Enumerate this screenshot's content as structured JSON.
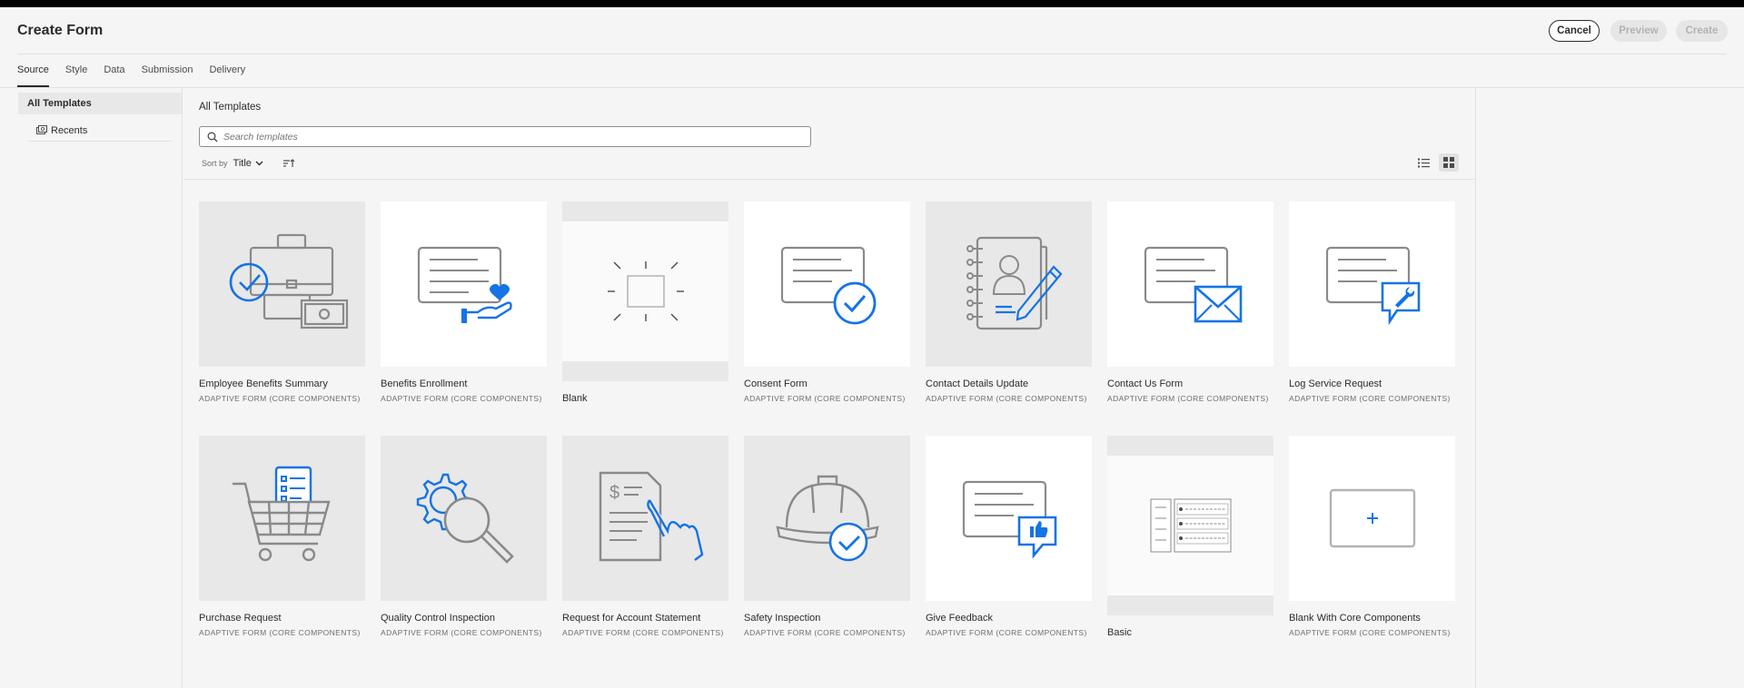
{
  "header": {
    "title": "Create Form",
    "cancel_label": "Cancel",
    "preview_label": "Preview",
    "create_label": "Create"
  },
  "tabs": [
    {
      "label": "Source",
      "active": true
    },
    {
      "label": "Style"
    },
    {
      "label": "Data"
    },
    {
      "label": "Submission"
    },
    {
      "label": "Delivery"
    }
  ],
  "sidebar": {
    "items": [
      {
        "label": "All Templates",
        "selected": true
      },
      {
        "label": "Recents",
        "icon": "recents-icon"
      }
    ]
  },
  "content": {
    "title": "All Templates",
    "search": {
      "placeholder": "Search templates",
      "value": ""
    },
    "sort": {
      "label": "Sort by",
      "value": "Title"
    }
  },
  "templates": [
    {
      "name": "Employee Benefits Summary",
      "type": "ADAPTIVE FORM (CORE COMPONENTS)",
      "icon": "briefcase-money-check-icon"
    },
    {
      "name": "Benefits Enrollment",
      "type": "ADAPTIVE FORM (CORE COMPONENTS)",
      "icon": "form-heart-hand-icon"
    },
    {
      "name": "Blank",
      "type": "",
      "icon": "blank-canvas-icon"
    },
    {
      "name": "Consent Form",
      "type": "ADAPTIVE FORM (CORE COMPONENTS)",
      "icon": "form-checkmark-icon"
    },
    {
      "name": "Contact Details Update",
      "type": "ADAPTIVE FORM (CORE COMPONENTS)",
      "icon": "address-book-pen-icon"
    },
    {
      "name": "Contact Us Form",
      "type": "ADAPTIVE FORM (CORE COMPONENTS)",
      "icon": "form-envelope-icon"
    },
    {
      "name": "Log Service Request",
      "type": "ADAPTIVE FORM (CORE COMPONENTS)",
      "icon": "form-wrench-bubble-icon"
    },
    {
      "name": "Purchase Request",
      "type": "ADAPTIVE FORM (CORE COMPONENTS)",
      "icon": "shopping-cart-icon"
    },
    {
      "name": "Quality Control Inspection",
      "type": "ADAPTIVE FORM (CORE COMPONENTS)",
      "icon": "gear-magnifier-icon"
    },
    {
      "name": "Request for Account Statement",
      "type": "ADAPTIVE FORM (CORE COMPONENTS)",
      "icon": "document-hand-icon"
    },
    {
      "name": "Safety Inspection",
      "type": "ADAPTIVE FORM (CORE COMPONENTS)",
      "icon": "hard-hat-check-icon"
    },
    {
      "name": "Give Feedback",
      "type": "ADAPTIVE FORM (CORE COMPONENTS)",
      "icon": "form-thumbs-up-icon"
    },
    {
      "name": "Basic",
      "type": "",
      "icon": "basic-layout-icon"
    },
    {
      "name": "Blank With Core Components",
      "type": "ADAPTIVE FORM (CORE COMPONENTS)",
      "icon": "plus-box-icon"
    }
  ],
  "colors": {
    "accent": "#1473e6",
    "icon_gray": "#8a8a8a"
  }
}
